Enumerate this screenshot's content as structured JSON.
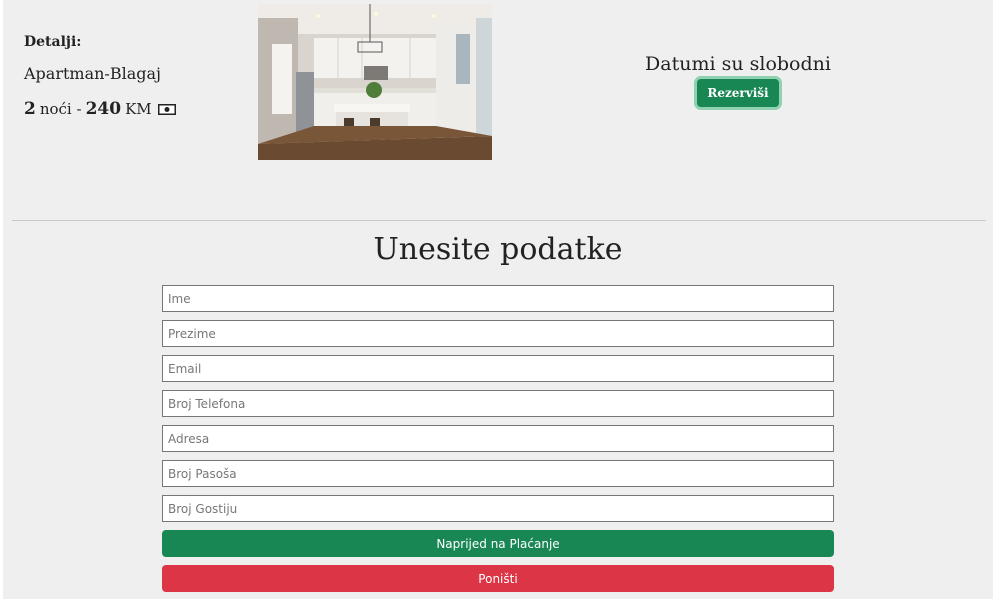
{
  "details": {
    "label": "Detalji:",
    "name": "Apartman-Blagaj",
    "nights": "2",
    "nights_text": "noći -",
    "price": "240",
    "currency": "KM",
    "price_icon": "cash-icon"
  },
  "photo": {
    "subject": "kitchen interior photo"
  },
  "availability": {
    "status": "Datumi su slobodni",
    "reserve_label": "Rezerviši"
  },
  "form": {
    "title": "Unesite podatke",
    "fields": [
      {
        "placeholder": "Ime",
        "value": ""
      },
      {
        "placeholder": "Prezime",
        "value": ""
      },
      {
        "placeholder": "Email",
        "value": ""
      },
      {
        "placeholder": "Broj Telefona",
        "value": ""
      },
      {
        "placeholder": "Adresa",
        "value": ""
      },
      {
        "placeholder": "Broj Pasoša",
        "value": ""
      },
      {
        "placeholder": "Broj Gostiju",
        "value": ""
      }
    ],
    "submit_label": "Naprijed na Plaćanje",
    "cancel_label": "Poništi"
  },
  "colors": {
    "primary_green": "#198754",
    "danger_red": "#dc3545",
    "background": "#efefef"
  }
}
